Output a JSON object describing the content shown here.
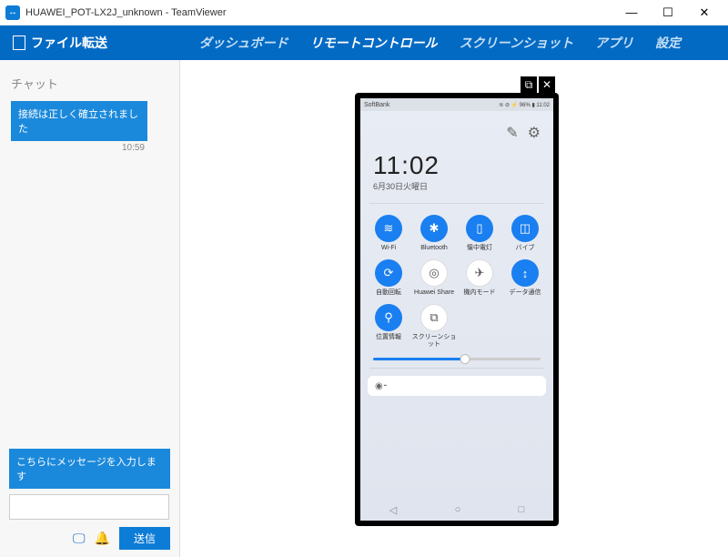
{
  "window": {
    "title": "HUAWEI_POT-LX2J_unknown - TeamViewer",
    "min": "—",
    "max": "☐",
    "close": "✕"
  },
  "nav": {
    "file_transfer": "ファイル転送",
    "items": [
      "ダッシュボード",
      "リモートコントロール",
      "スクリーンショット",
      "アプリ",
      "設定"
    ],
    "active_index": 1
  },
  "chat": {
    "title": "チャット",
    "bubble": "接続は正しく確立されました",
    "time": "10:59",
    "input_label": "こちらにメッセージを入力します",
    "send": "送信"
  },
  "phone": {
    "carrier": "SoftBank",
    "status_right": "≋ ⊘ ⚡ 96% ▮ 11:02",
    "time": "11:02",
    "date": "6月30日火曜日",
    "tiles": [
      {
        "icon": "wifi-icon",
        "glyph": "≋",
        "label": "Wi-Fi",
        "on": true
      },
      {
        "icon": "bluetooth-icon",
        "glyph": "✱",
        "label": "Bluetooth",
        "on": true
      },
      {
        "icon": "flashlight-icon",
        "glyph": "▯",
        "label": "懐中電灯",
        "on": true
      },
      {
        "icon": "vibrate-icon",
        "glyph": "◫",
        "label": "バイブ",
        "on": true
      },
      {
        "icon": "autorotate-icon",
        "glyph": "⟳",
        "label": "自動回転",
        "on": true
      },
      {
        "icon": "huawei-share-icon",
        "glyph": "◎",
        "label": "Huawei Share",
        "on": false
      },
      {
        "icon": "airplane-icon",
        "glyph": "✈",
        "label": "機内モード",
        "on": false
      },
      {
        "icon": "data-icon",
        "glyph": "↕",
        "label": "データ通信",
        "on": true
      },
      {
        "icon": "location-icon",
        "glyph": "⚲",
        "label": "位置情報",
        "on": true
      },
      {
        "icon": "screenshot-icon",
        "glyph": "⧉",
        "label": "スクリーンショット",
        "on": false
      }
    ],
    "notif_icon": "◉⁃",
    "nav_back": "◁",
    "nav_home": "○",
    "nav_recent": "□",
    "popout": "⧉",
    "popclose": "✕",
    "edit": "✎",
    "gear": "⚙"
  }
}
